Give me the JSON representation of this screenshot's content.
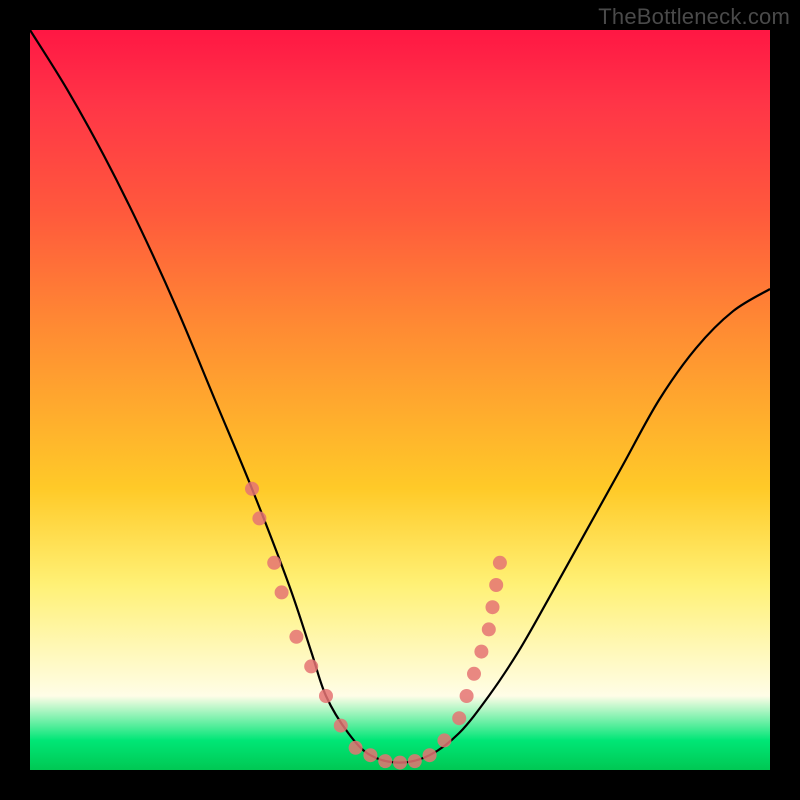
{
  "watermark": "TheBottleneck.com",
  "chart_data": {
    "type": "line",
    "title": "",
    "xlabel": "",
    "ylabel": "",
    "xlim": [
      0,
      100
    ],
    "ylim": [
      0,
      100
    ],
    "series": [
      {
        "name": "bottleneck-curve",
        "x": [
          0,
          5,
          10,
          15,
          20,
          25,
          30,
          35,
          38,
          40,
          43,
          46,
          50,
          54,
          58,
          62,
          66,
          70,
          75,
          80,
          85,
          90,
          95,
          100
        ],
        "y": [
          100,
          92,
          83,
          73,
          62,
          50,
          38,
          25,
          16,
          10,
          5,
          2,
          1,
          2,
          5,
          10,
          16,
          23,
          32,
          41,
          50,
          57,
          62,
          65
        ]
      }
    ],
    "markers_left": {
      "name": "left-cluster",
      "points": [
        {
          "x": 30,
          "y": 38
        },
        {
          "x": 31,
          "y": 34
        },
        {
          "x": 33,
          "y": 28
        },
        {
          "x": 34,
          "y": 24
        },
        {
          "x": 36,
          "y": 18
        },
        {
          "x": 38,
          "y": 14
        },
        {
          "x": 40,
          "y": 10
        },
        {
          "x": 42,
          "y": 6
        },
        {
          "x": 44,
          "y": 3
        }
      ]
    },
    "markers_bottom": {
      "name": "bottom-cluster",
      "points": [
        {
          "x": 46,
          "y": 2
        },
        {
          "x": 48,
          "y": 1.2
        },
        {
          "x": 50,
          "y": 1
        },
        {
          "x": 52,
          "y": 1.2
        },
        {
          "x": 54,
          "y": 2
        }
      ]
    },
    "markers_right": {
      "name": "right-cluster",
      "points": [
        {
          "x": 56,
          "y": 4
        },
        {
          "x": 58,
          "y": 7
        },
        {
          "x": 59,
          "y": 10
        },
        {
          "x": 60,
          "y": 13
        },
        {
          "x": 61,
          "y": 16
        },
        {
          "x": 62,
          "y": 19
        },
        {
          "x": 62.5,
          "y": 22
        },
        {
          "x": 63,
          "y": 25
        },
        {
          "x": 63.5,
          "y": 28
        }
      ]
    }
  }
}
